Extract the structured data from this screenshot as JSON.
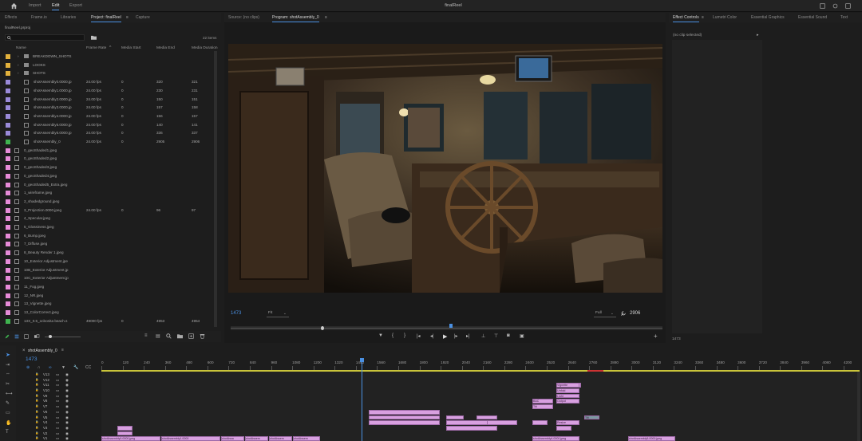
{
  "topbar": {
    "tabs": [
      "Import",
      "Edit",
      "Export"
    ],
    "active_tab": "Edit",
    "title": "finalReel"
  },
  "left_tabs": [
    "Effects",
    "Frame.io",
    "Libraries",
    "Project: finalReel",
    "Capture"
  ],
  "project": {
    "file": "finalReel.prproj",
    "item_count": "22 items",
    "search_placeholder": "",
    "columns": [
      "Name",
      "Frame Rate",
      "Media Start",
      "Media End",
      "Media Duration"
    ],
    "rows": [
      {
        "name": "BREAKDOWN_SHOTS",
        "rate": "",
        "start": "",
        "end": "",
        "dur": "",
        "type": "folder",
        "color": "#e2b13c"
      },
      {
        "name": "LOOKS",
        "rate": "",
        "start": "",
        "end": "",
        "dur": "",
        "type": "folder",
        "color": "#e2b13c"
      },
      {
        "name": "SHOTS",
        "rate": "",
        "start": "",
        "end": "",
        "dur": "",
        "type": "folder",
        "color": "#e2b13c"
      },
      {
        "name": "shotAssembly0.0000.jp",
        "rate": "24.00 fps",
        "start": "0",
        "end": "320",
        "dur": "321",
        "type": "seq",
        "color": "#9a8ad8"
      },
      {
        "name": "shotAssembly1.0000.jp",
        "rate": "24.00 fps",
        "start": "0",
        "end": "230",
        "dur": "231",
        "type": "seq",
        "color": "#9a8ad8"
      },
      {
        "name": "shotAssembly2.0000.jp",
        "rate": "24.00 fps",
        "start": "0",
        "end": "150",
        "dur": "151",
        "type": "seq",
        "color": "#9a8ad8"
      },
      {
        "name": "shotAssembly3.0000.jp",
        "rate": "24.00 fps",
        "start": "0",
        "end": "157",
        "dur": "158",
        "type": "seq",
        "color": "#9a8ad8"
      },
      {
        "name": "shotAssembly4.0000.jp",
        "rate": "24.00 fps",
        "start": "0",
        "end": "156",
        "dur": "157",
        "type": "seq",
        "color": "#9a8ad8"
      },
      {
        "name": "shotAssembly5.0000.jp",
        "rate": "24.00 fps",
        "start": "0",
        "end": "140",
        "dur": "141",
        "type": "seq",
        "color": "#9a8ad8"
      },
      {
        "name": "shotAssembly6.0000.jp",
        "rate": "24.00 fps",
        "start": "0",
        "end": "336",
        "dur": "337",
        "type": "seq",
        "color": "#9a8ad8"
      },
      {
        "name": "shotAssembly_0",
        "rate": "24.00 fps",
        "start": "0",
        "end": "2905",
        "dur": "2906",
        "type": "sequence",
        "color": "#3fb34f"
      },
      {
        "name": "0_geoShaded1.jpeg",
        "rate": "",
        "start": "",
        "end": "",
        "dur": "",
        "type": "file",
        "color": "#e68bd8"
      },
      {
        "name": "0_geoShaded2.jpeg",
        "rate": "",
        "start": "",
        "end": "",
        "dur": "",
        "type": "file",
        "color": "#e68bd8"
      },
      {
        "name": "0_geoShaded3.jpeg",
        "rate": "",
        "start": "",
        "end": "",
        "dur": "",
        "type": "file",
        "color": "#e68bd8"
      },
      {
        "name": "0_geoShaded4.jpeg",
        "rate": "",
        "start": "",
        "end": "",
        "dur": "",
        "type": "file",
        "color": "#e68bd8"
      },
      {
        "name": "0_geoShaded5_Extra.jpeg",
        "rate": "",
        "start": "",
        "end": "",
        "dur": "",
        "type": "file",
        "color": "#e68bd8"
      },
      {
        "name": "1_wireframe.jpeg",
        "rate": "",
        "start": "",
        "end": "",
        "dur": "",
        "type": "file",
        "color": "#e68bd8"
      },
      {
        "name": "2_shadedground.jpeg",
        "rate": "",
        "start": "",
        "end": "",
        "dur": "",
        "type": "file",
        "color": "#e68bd8"
      },
      {
        "name": "3_Projection.0000.jpeg",
        "rate": "24.00 fps",
        "start": "0",
        "end": "96",
        "dur": "97",
        "type": "file",
        "color": "#e68bd8"
      },
      {
        "name": "4_Specular.jpeg",
        "rate": "",
        "start": "",
        "end": "",
        "dur": "",
        "type": "file",
        "color": "#e68bd8"
      },
      {
        "name": "5_Glossiness.jpeg",
        "rate": "",
        "start": "",
        "end": "",
        "dur": "",
        "type": "file",
        "color": "#e68bd8"
      },
      {
        "name": "6_Bump.jpeg",
        "rate": "",
        "start": "",
        "end": "",
        "dur": "",
        "type": "file",
        "color": "#e68bd8"
      },
      {
        "name": "7_Diffuse.jpeg",
        "rate": "",
        "start": "",
        "end": "",
        "dur": "",
        "type": "file",
        "color": "#e68bd8"
      },
      {
        "name": "8_Beauty Render 1.jpeg",
        "rate": "",
        "start": "",
        "end": "",
        "dur": "",
        "type": "file",
        "color": "#e68bd8"
      },
      {
        "name": "10_Exterior Adjustment.jpe",
        "rate": "",
        "start": "",
        "end": "",
        "dur": "",
        "type": "file",
        "color": "#e68bd8"
      },
      {
        "name": "10B_Exterior Adjustment.jp",
        "rate": "",
        "start": "",
        "end": "",
        "dur": "",
        "type": "file",
        "color": "#e68bd8"
      },
      {
        "name": "10C_Exterior Adjustment.jp",
        "rate": "",
        "start": "",
        "end": "",
        "dur": "",
        "type": "file",
        "color": "#e68bd8"
      },
      {
        "name": "11_Fog.jpeg",
        "rate": "",
        "start": "",
        "end": "",
        "dur": "",
        "type": "file",
        "color": "#e68bd8"
      },
      {
        "name": "12_NR.jpeg",
        "rate": "",
        "start": "",
        "end": "",
        "dur": "",
        "type": "file",
        "color": "#e68bd8"
      },
      {
        "name": "13_Vignette.jpeg",
        "rate": "",
        "start": "",
        "end": "",
        "dur": "",
        "type": "file",
        "color": "#e68bd8"
      },
      {
        "name": "13_ColorCorrect.jpeg",
        "rate": "",
        "start": "",
        "end": "",
        "dur": "",
        "type": "file",
        "color": "#e68bd8"
      },
      {
        "name": "13X_0.5_ocbonita beach.s",
        "rate": "49000 fps",
        "start": "0",
        "end": "4953",
        "dur": "4954",
        "type": "file",
        "color": "#3fb34f"
      }
    ]
  },
  "source_tab": "Source: (no clips)",
  "program_tab": "Program: shotAssembly_0",
  "program": {
    "timecode": "1473",
    "zoom": "Fit",
    "quality": "Full",
    "duration": "2906",
    "playhead_fraction": 0.507
  },
  "right_tabs": [
    "Effect Controls",
    "Lumetri Color",
    "Essential Graphics",
    "Essential Sound",
    "Text"
  ],
  "effect_controls": {
    "no_clip": "(no clip selected)",
    "timecode": "1473"
  },
  "timeline": {
    "sequence_tab": "shotAssembly_0",
    "timecode": "1473",
    "ruler": [
      "0",
      "120",
      "240",
      "360",
      "480",
      "600",
      "720",
      "840",
      "960",
      "1080",
      "1200",
      "1320",
      "1440",
      "1560",
      "1680",
      "1800",
      "1920",
      "2040",
      "2160",
      "2280",
      "2400",
      "2520",
      "2640",
      "2760",
      "2880",
      "3000",
      "3120",
      "3240",
      "3360",
      "3480",
      "3600",
      "3720",
      "3840",
      "3960",
      "4080",
      "4200"
    ],
    "tracks": [
      "V13",
      "V12",
      "V11",
      "V10",
      "V9",
      "V8",
      "V7",
      "V6",
      "V5",
      "V4",
      "V3",
      "V2",
      "V1"
    ],
    "clip_labels": [
      "shotAssembly0.0000.jpeg",
      "shotAssembly1.0000",
      "shotAssa",
      "shotAssem",
      "shotAssem",
      "shotAssem",
      "shotAssembly4.0000.jpeg",
      "shotAssembly5.0000.jpeg",
      "Vignette",
      "Unfold",
      "Light",
      "Output",
      "BAC",
      "Tilt",
      "Resize"
    ],
    "playhead_frame": 1473,
    "ruler_max": 4200
  },
  "colors": {
    "accent": "#4a90e2",
    "seq": "#9a8ad8",
    "file": "#e68bd8",
    "folder": "#e2b13c",
    "green": "#3fb34f",
    "clip": "#d8a0e0"
  }
}
